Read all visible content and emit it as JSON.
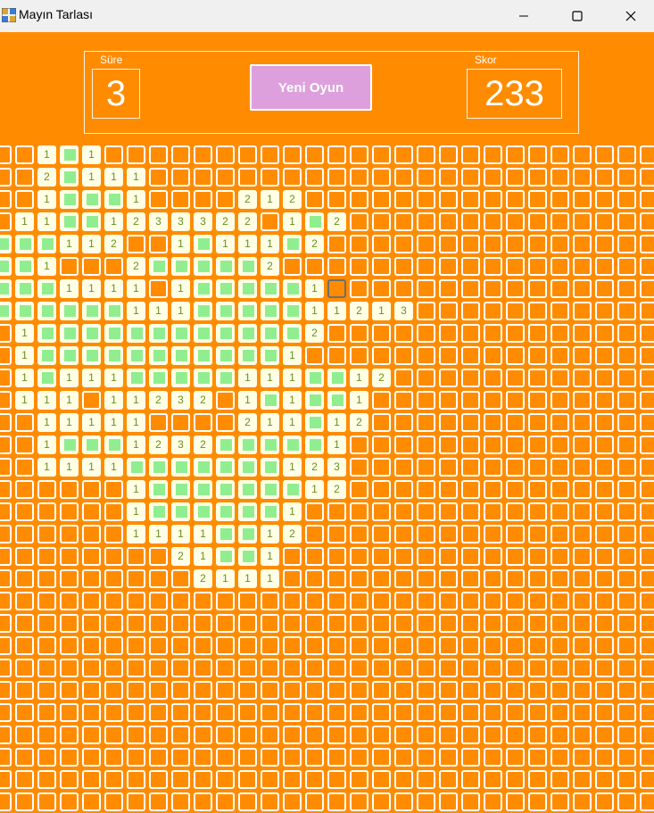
{
  "window": {
    "title": "Mayın Tarlası",
    "icon": "minesweeper-app-icon",
    "buttons": [
      "minimize-icon",
      "maximize-icon",
      "close-icon"
    ]
  },
  "header": {
    "timer_label": "Süre",
    "timer_value": "3",
    "new_game_label": "Yeni Oyun",
    "score_label": "Skor",
    "score_value": "233"
  },
  "colors": {
    "background": "#ff8c00",
    "hidden_cell_border": "#ffffff",
    "open_cell": "#ffffe6",
    "empty_marker": "#90ee90",
    "number_text": "#6b8e23",
    "new_game_button": "#dda0dd"
  },
  "board": {
    "legend": "#=hidden, .=opened empty, digit=adjacent mine count, S=selected hidden cell",
    "rows": [
      "##1.1##########################",
      "##2.111#########################",
      "##1...1####212##################",
      "#11..1233322#1.2################",
      "...112##1.111.2#################",
      "..1###2.....2###################",
      "...1111#1.....1S################",
      "......111.....11213#############",
      "#1............2#################",
      "#1...........1##################",
      "#1.111.....111..12##############",
      "#111#11232#1.1..1###############",
      "##11111####211.12###############",
      "##1...1232.....1################",
      "##1111.......123################",
      "######1.......12################",
      "######1......1##################",
      "######1111..12##################",
      "########21..1###################",
      "#########2111###################",
      "################################",
      "################################",
      "################################",
      "################################",
      "################################",
      "################################",
      "################################",
      "################################",
      "################################",
      "################################",
      "################################"
    ]
  }
}
